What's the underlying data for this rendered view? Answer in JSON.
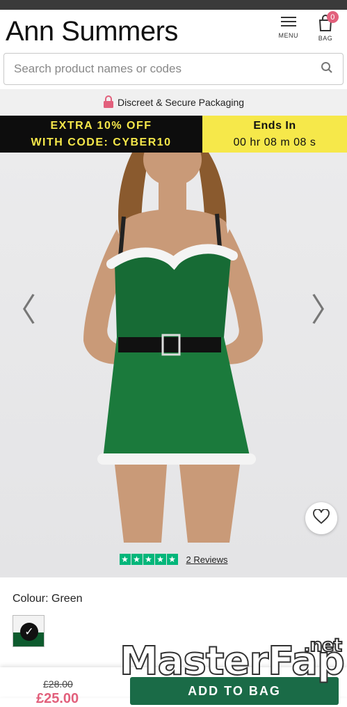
{
  "header": {
    "logo": "Ann Summers",
    "menu_label": "MENU",
    "bag_label": "BAG",
    "bag_count": "0"
  },
  "search": {
    "placeholder": "Search product names or codes"
  },
  "secure_banner": "Discreet & Secure Packaging",
  "promo": {
    "line1": "EXTRA 10% OFF",
    "line2": "WITH CODE: CYBER10",
    "ends_label": "Ends In",
    "countdown": "00 hr 08 m 08 s"
  },
  "product": {
    "reviews_text": "2 Reviews",
    "rating": 5,
    "colour_label": "Colour: Green"
  },
  "purchase": {
    "old_price": "£28.00",
    "new_price": "£25.00",
    "add_label": "ADD TO BAG"
  },
  "watermark": {
    "text": "MasterFap",
    "domain": ".net"
  },
  "colors": {
    "promo_yellow": "#f6e84a",
    "accent_pink": "#e2607c",
    "trustpilot_green": "#00b67a",
    "button_green": "#1a6b47"
  }
}
